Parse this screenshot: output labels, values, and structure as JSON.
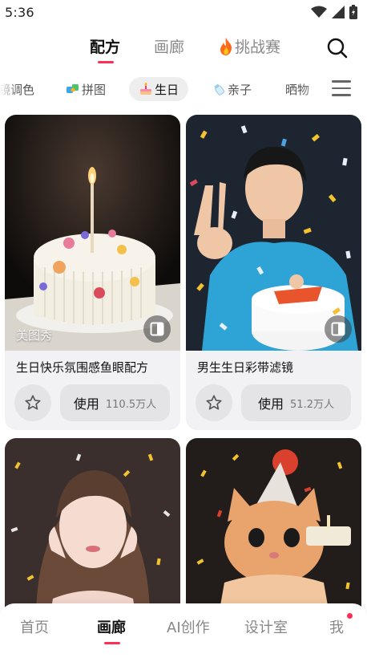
{
  "status_bar": {
    "time": "5:36"
  },
  "top_nav": {
    "tabs": [
      {
        "label": "配方",
        "active": true
      },
      {
        "label": "画廊",
        "active": false
      },
      {
        "label": "挑战赛",
        "active": false,
        "icon": "fire-icon"
      }
    ],
    "search_icon": "search-icon"
  },
  "categories": {
    "items": [
      {
        "label": "镜调色",
        "icon": ""
      },
      {
        "label": "拼图",
        "icon": "puzzle-icon"
      },
      {
        "label": "生日",
        "icon": "cake-icon",
        "active": true
      },
      {
        "label": "亲子",
        "icon": "baby-bottle-icon"
      },
      {
        "label": "晒物",
        "icon": ""
      }
    ],
    "menu_icon": "menu-icon"
  },
  "cards": [
    {
      "title": "生日快乐氛围感鱼眼配方",
      "use_label": "使用",
      "use_count": "110.5万人",
      "watermark": "美图秀"
    },
    {
      "title": "男生生日彩带滤镜",
      "use_label": "使用",
      "use_count": "51.2万人"
    },
    {
      "title": "",
      "use_label": "",
      "use_count": ""
    },
    {
      "title": "",
      "use_label": "",
      "use_count": ""
    }
  ],
  "bottom_nav": {
    "tabs": [
      {
        "label": "首页",
        "active": false
      },
      {
        "label": "画廊",
        "active": true
      },
      {
        "label": "AI创作",
        "active": false
      },
      {
        "label": "设计室",
        "active": false
      },
      {
        "label": "我",
        "active": false,
        "badge": true
      }
    ]
  },
  "colors": {
    "accent": "#ff2e55",
    "fire": "#ff6a1a",
    "card_bg": "#f2f2f4",
    "button_bg": "#e4e4e7"
  }
}
